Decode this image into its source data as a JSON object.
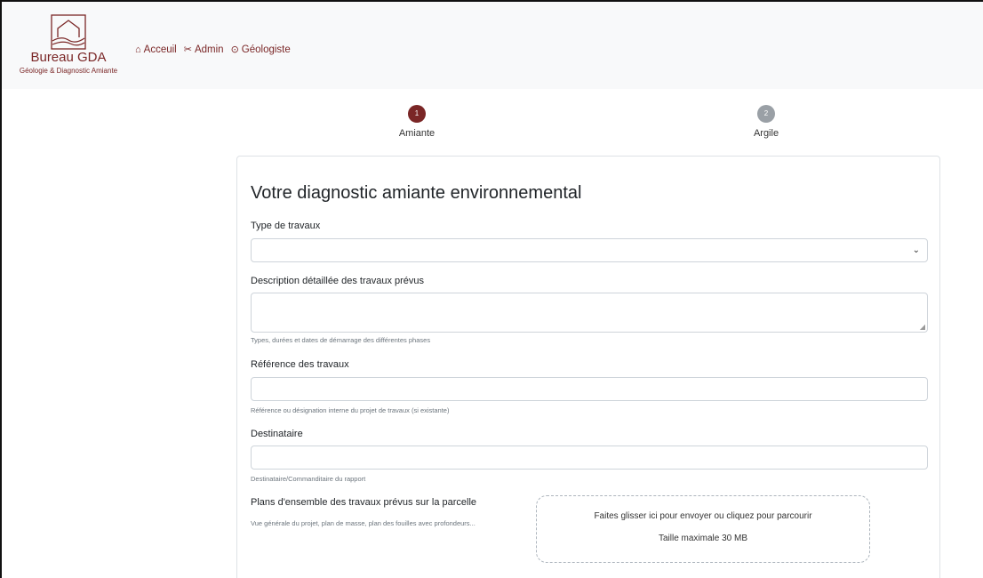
{
  "brand": {
    "logo_icon": "house-hills-logo",
    "title": "Bureau GDA",
    "subtitle": "Géologie & Diagnostic Amiante",
    "color": "#7a2626"
  },
  "nav": {
    "items": [
      {
        "icon": "home-icon",
        "glyph": "⌂",
        "label": "Acceuil"
      },
      {
        "icon": "tools-icon",
        "glyph": "✂",
        "label": "Admin"
      },
      {
        "icon": "compass-icon",
        "glyph": "⊙",
        "label": "Géologiste"
      }
    ]
  },
  "stepper": {
    "steps": [
      {
        "number": "1",
        "label": "Amiante",
        "active": true
      },
      {
        "number": "2",
        "label": "Argile",
        "active": false
      }
    ]
  },
  "form": {
    "title": "Votre diagnostic amiante environnemental",
    "type_travaux": {
      "label": "Type de travaux",
      "value": ""
    },
    "description": {
      "label": "Description détaillée des travaux prévus",
      "value": "",
      "help": "Types, durées et dates de démarrage des différentes phases"
    },
    "reference": {
      "label": "Référence des travaux",
      "value": "",
      "help": "Référence ou désignation interne du projet de travaux (si existante)"
    },
    "destinataire": {
      "label": "Destinataire",
      "value": "",
      "help": "Destinataire/Commanditaire du rapport"
    },
    "plans": {
      "label": "Plans d'ensemble des travaux prévus sur la parcelle",
      "help": "Vue générale du projet, plan de masse, plan des fouilles avec profondeurs...",
      "dropzone_text": "Faites glisser ici pour envoyer ou cliquez pour parcourir",
      "dropzone_size": "Taille maximale 30 MB"
    }
  }
}
